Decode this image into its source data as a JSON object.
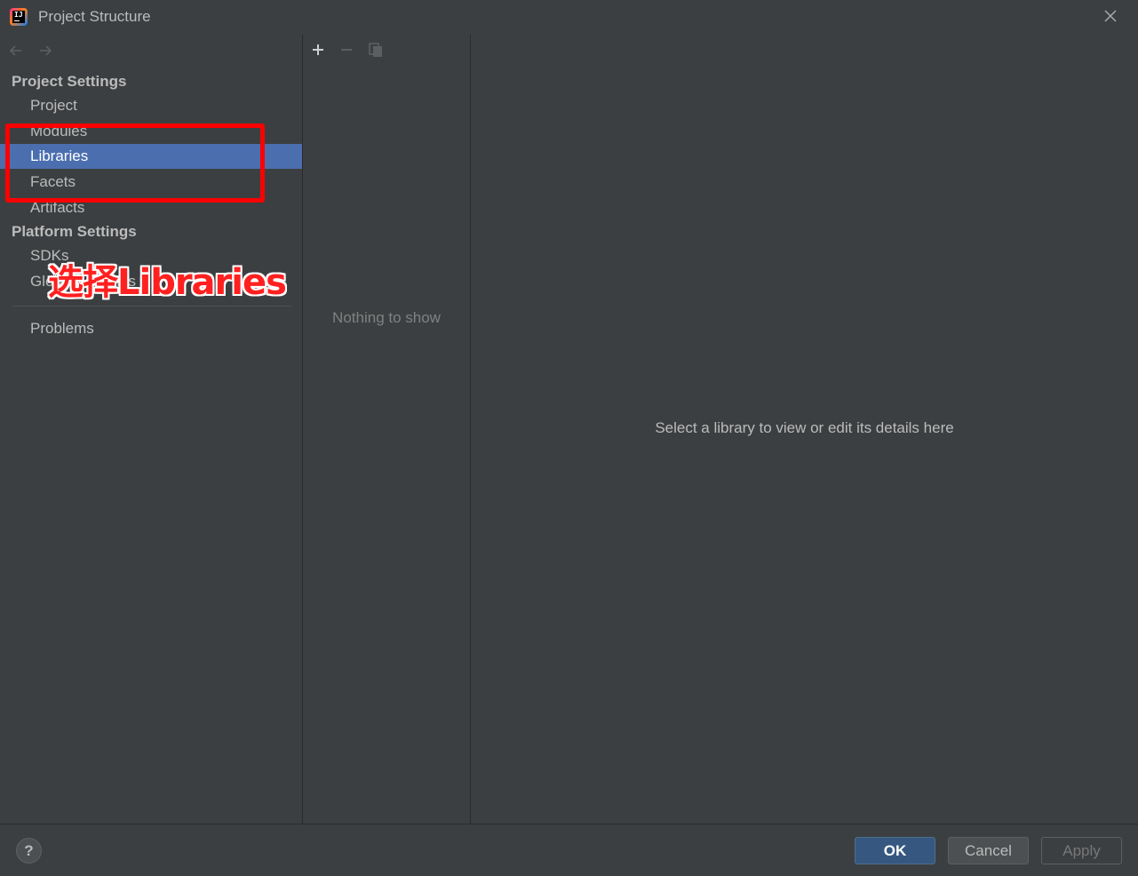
{
  "window": {
    "title": "Project Structure"
  },
  "sidebar": {
    "project_settings_header": "Project Settings",
    "project_items": [
      {
        "label": "Project",
        "selected": false
      },
      {
        "label": "Modules",
        "selected": false
      },
      {
        "label": "Libraries",
        "selected": true
      },
      {
        "label": "Facets",
        "selected": false
      },
      {
        "label": "Artifacts",
        "selected": false
      }
    ],
    "platform_settings_header": "Platform Settings",
    "platform_items": [
      {
        "label": "SDKs"
      },
      {
        "label": "Global Libraries"
      }
    ],
    "problems_label": "Problems"
  },
  "middle": {
    "empty_text": "Nothing to show"
  },
  "detail": {
    "placeholder": "Select a library to view or edit its details here"
  },
  "footer": {
    "help_label": "?",
    "ok_label": "OK",
    "cancel_label": "Cancel",
    "apply_label": "Apply"
  },
  "annotation": {
    "text": "选择Libraries",
    "color": "#ff0000"
  },
  "colors": {
    "selection": "#4b6eaf",
    "background": "#3c3f41",
    "ok_button": "#365880"
  }
}
